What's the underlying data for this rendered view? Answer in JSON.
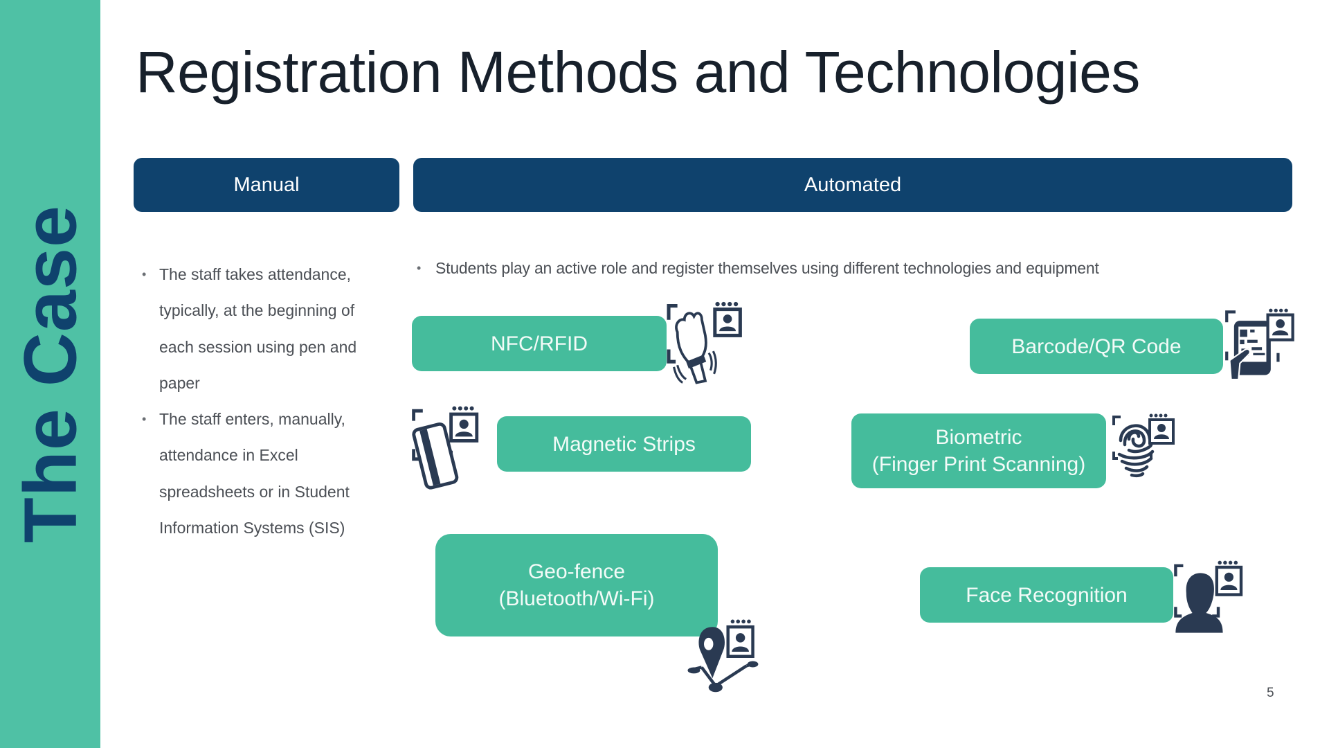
{
  "sidebar": {
    "title": "The Case"
  },
  "page": {
    "title": "Registration Methods and Technologies",
    "number": "5"
  },
  "colors": {
    "teal": "#4fc1a5",
    "box_teal": "#45bc9c",
    "navy": "#0f426d",
    "icon_dark": "#2a3a52"
  },
  "manual": {
    "header": "Manual",
    "bullets": [
      "The staff takes attendance, typically, at the beginning of each session using pen and paper",
      "The staff enters, manually, attendance in Excel spreadsheets or in Student Information Systems (SIS)"
    ]
  },
  "automated": {
    "header": "Automated",
    "bullets": [
      "Students play an active role and register themselves using different technologies and equipment"
    ],
    "methods": [
      {
        "line1": "NFC/RFID",
        "line2": "",
        "icon": "wristband-icon"
      },
      {
        "line1": "Barcode/QR Code",
        "line2": "",
        "icon": "qr-phone-icon"
      },
      {
        "line1": "Magnetic Strips",
        "line2": "",
        "icon": "magnetic-card-icon"
      },
      {
        "line1": "Biometric",
        "line2": "(Finger Print Scanning)",
        "icon": "fingerprint-icon"
      },
      {
        "line1": "Geo-fence",
        "line2": "(Bluetooth/Wi-Fi)",
        "icon": "location-pin-icon"
      },
      {
        "line1": "Face Recognition",
        "line2": "",
        "icon": "face-silhouette-icon"
      }
    ]
  },
  "bullet_glyph": "•"
}
